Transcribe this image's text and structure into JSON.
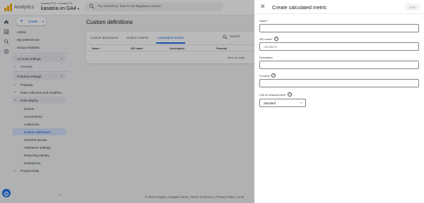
{
  "header": {
    "app_name": "Analytics",
    "account_path": "Kasatria PH1 > Kasatria PH",
    "property_name": "kasatria.vn GA4",
    "property_caret": "▾",
    "search_placeholder": "Try searching \"how to do BigQuery export\""
  },
  "create_button": {
    "label": "Create",
    "plus": "+",
    "caret": "▾"
  },
  "sidebar": {
    "items": [
      {
        "label": "Admin"
      },
      {
        "label": "My preferences"
      },
      {
        "label": "Setup Assistant"
      }
    ],
    "account_settings": {
      "title": "Account settings",
      "chevron": "▴",
      "items": [
        {
          "label": "Account",
          "arrow": "▸"
        }
      ]
    },
    "property_settings": {
      "title": "Property settings",
      "chevron": "▴",
      "items": [
        {
          "label": "Property",
          "arrow": "▸"
        },
        {
          "label": "Data collection and modifica...",
          "arrow": "▸"
        },
        {
          "label": "Data display",
          "arrow": "▾"
        }
      ],
      "data_display_items": [
        {
          "label": "Events"
        },
        {
          "label": "Conversions"
        },
        {
          "label": "Audiences"
        },
        {
          "label": "Custom definitions"
        },
        {
          "label": "Channel groups"
        },
        {
          "label": "Attribution settings"
        },
        {
          "label": "Reporting identity"
        },
        {
          "label": "DebugView"
        }
      ],
      "product_links": {
        "label": "Product links",
        "arrow": "▸"
      }
    },
    "collapse_arrow": "‹"
  },
  "main": {
    "title": "Custom definitions",
    "tabs": [
      {
        "label": "Custom dimensions"
      },
      {
        "label": "Custom metrics"
      },
      {
        "label": "Calculated metrics"
      }
    ],
    "search_label": "Search",
    "columns": [
      {
        "label": "Name ↑"
      },
      {
        "label": "API name"
      },
      {
        "label": "Description"
      },
      {
        "label": "Formula"
      }
    ],
    "items_per_page": "Items per page:"
  },
  "footer": {
    "text": "© 2023 Google | Analytics home | Terms of Service | Privacy Policy | ⊡ Se"
  },
  "panel": {
    "close": "✕",
    "title": "Create calculated metric",
    "save_label": "Save",
    "name": {
      "label": "Name*",
      "value": ""
    },
    "api_name": {
      "label": "API name*",
      "help": "?",
      "value": "calcMetric:"
    },
    "description": {
      "label": "Description",
      "value": ""
    },
    "formula": {
      "label": "Formula*",
      "help": "?",
      "value": ""
    },
    "unit": {
      "label": "Unit of measurement*",
      "help": "?",
      "value": "Standard",
      "caret": "▾"
    }
  },
  "colors": {
    "accent": "#1a73e8",
    "logo": "#f9ab00",
    "active_nav_bg": "#d3e3fd",
    "scrim": "rgba(0,0,0,0.27)"
  },
  "icons": {
    "rail": [
      "home-icon",
      "reports-icon",
      "explore-icon",
      "advertising-icon"
    ],
    "settings": "gear-icon",
    "search": "search-icon"
  }
}
